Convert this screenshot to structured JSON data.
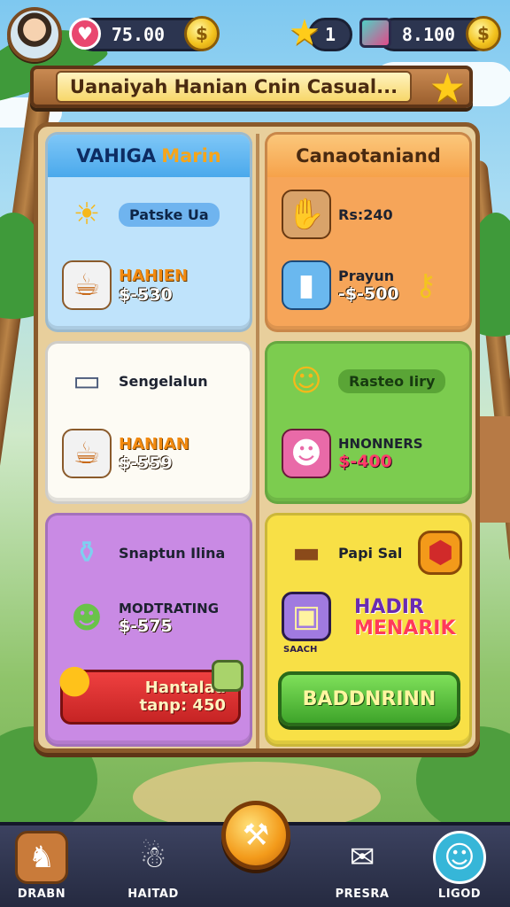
{
  "topbar": {
    "coins": "75.00",
    "stars": "1",
    "gems": "8.100"
  },
  "banner": {
    "title": "Uanaiyah Hanian Cnin Casual..."
  },
  "cards": {
    "blue": {
      "title_part1": "VAHIGA",
      "title_part2": "Marin",
      "item1_label": "Patske Ua",
      "item2_name": "HAHIEN",
      "item2_price": "$-530"
    },
    "orange": {
      "title": "Canaotaniand",
      "item1_label": "Rs:240",
      "item2_name": "Prayun",
      "item2_price": "-$-500"
    },
    "white": {
      "item1_label": "Sengelalun",
      "item2_name": "HANIAN",
      "item2_price": "$-559"
    },
    "green": {
      "item1_label": "Rasteo Iiry",
      "item2_name": "HNONNERS",
      "item2_price": "$-400"
    },
    "purple": {
      "item1_label": "Snaptun Ilina",
      "item2_name": "MODTRATING",
      "item2_price": "$-575",
      "ticket_line1": "Hantalaa",
      "ticket_line2": "tanp: 450"
    },
    "yellow": {
      "item1_label": "Papi Sal",
      "hadiah_line1": "HADIR",
      "hadiah_line2": "MENARIK",
      "badge_label": "SAACH",
      "claim_button": "BADDNRINN"
    }
  },
  "bottom_nav": {
    "items": [
      {
        "label": "DRABN"
      },
      {
        "label": "HAITAD"
      },
      {
        "label": ""
      },
      {
        "label": "PRESRA"
      },
      {
        "label": "LIGOD"
      }
    ]
  },
  "colors": {
    "coin": "#f3c41f",
    "star": "#ffcc1a",
    "board": "#e8cf9c",
    "claim_green": "#3ea42a"
  },
  "icons": [
    "avatar",
    "pink-gem-icon",
    "coin-icon",
    "star-icon",
    "chest-icon",
    "sun-star-icon",
    "coffee-cup-icon",
    "scroll-icon",
    "potion-icon",
    "key-icon",
    "phone-icon",
    "smiley-star-icon",
    "robot-icon",
    "bottle-icon",
    "frog-icon",
    "balloon-icon",
    "gift-icon",
    "log-icon",
    "hexagon-badge-icon",
    "picture-frame-icon",
    "camel-icon",
    "snowman-icon",
    "wrench-icon",
    "box-pin-icon",
    "profile-icon"
  ]
}
